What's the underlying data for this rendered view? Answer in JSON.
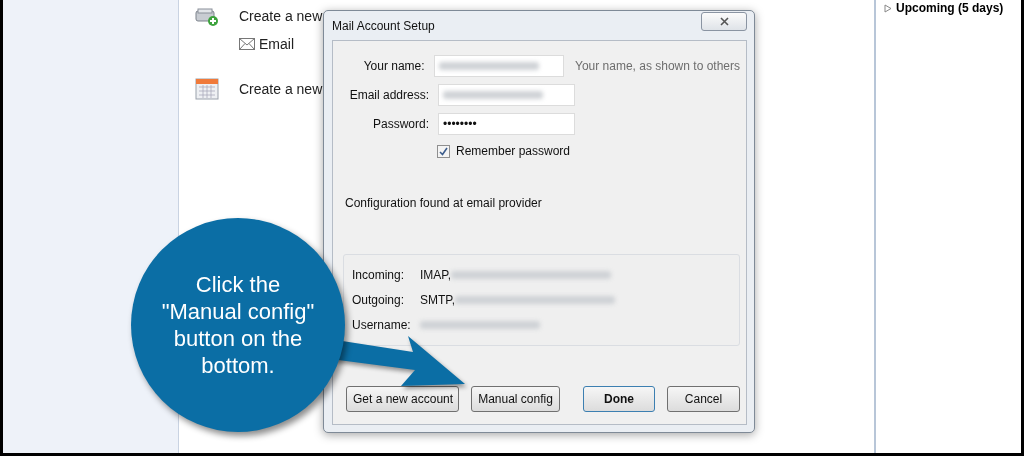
{
  "background": {
    "new_account_label": "Create a new",
    "email_item": "Email",
    "new_calendar_label": "Create a new",
    "upcoming": "Upcoming (5 days)"
  },
  "dialog": {
    "title": "Mail Account Setup",
    "fields": [
      {
        "label": "Your name:",
        "kind": "blurred",
        "hint": "Your name, as shown to others"
      },
      {
        "label": "Email address:",
        "kind": "blurred"
      },
      {
        "label": "Password:",
        "kind": "password",
        "value": "••••••••"
      }
    ],
    "remember": {
      "label": "Remember password",
      "checked": true
    },
    "status": "Configuration found at email provider",
    "servers": [
      {
        "label": "Incoming:",
        "value": "IMAP,"
      },
      {
        "label": "Outgoing:",
        "value": "SMTP,"
      },
      {
        "label": "Username:"
      }
    ],
    "buttons": [
      {
        "label": "Get a new account",
        "default": false
      },
      {
        "label": "Manual config",
        "default": false
      },
      {
        "label": "Done",
        "default": true
      },
      {
        "label": "Cancel",
        "default": false
      }
    ]
  },
  "callout": {
    "text": "Click the \"Manual config\" button on the bottom."
  }
}
